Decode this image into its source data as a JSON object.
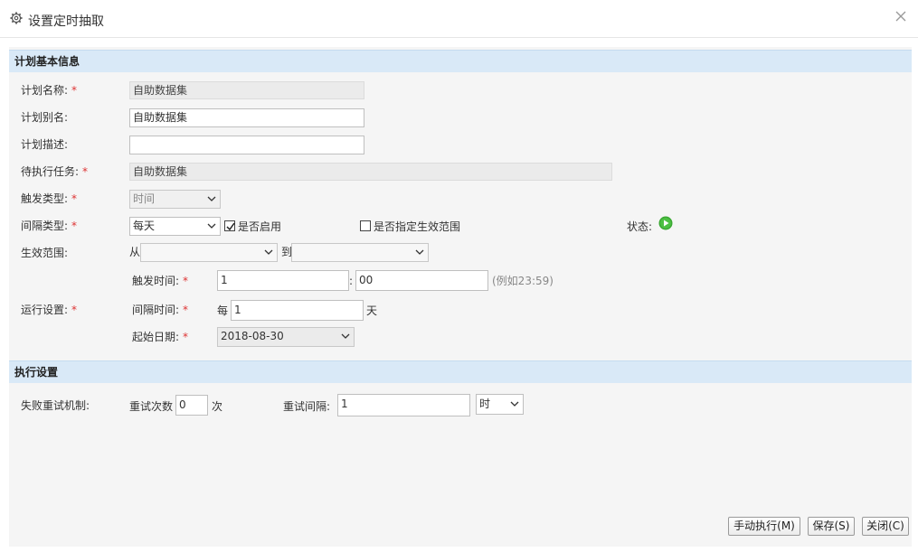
{
  "dialog": {
    "title": "设置定时抽取"
  },
  "sections": {
    "basic": "计划基本信息",
    "exec": "执行设置"
  },
  "form": {
    "plan_name_label": "计划名称:",
    "plan_name_value": "自助数据集",
    "plan_alias_label": "计划别名:",
    "plan_alias_value": "自助数据集",
    "plan_desc_label": "计划描述:",
    "plan_desc_value": "",
    "task_label": "待执行任务:",
    "task_value": "自助数据集",
    "trigger_type_label": "触发类型:",
    "trigger_type_value": "时间",
    "interval_type_label": "间隔类型:",
    "interval_type_value": "每天",
    "enable_label": "是否启用",
    "enable_checked": true,
    "range_spec_label": "是否指定生效范围",
    "range_spec_checked": false,
    "status_label": "状态:",
    "effective_range_label": "生效范围:",
    "from_label": "从",
    "to_label": "到",
    "from_value": "",
    "to_value": "",
    "run_settings_label": "运行设置:",
    "trigger_time_label": "触发时间:",
    "trigger_hour": "1",
    "time_sep": ":",
    "trigger_minute": "00",
    "trigger_time_hint": "(例如23:59)",
    "interval_time_label": "间隔时间:",
    "every_label": "每",
    "interval_value": "1",
    "day_unit": "天",
    "start_date_label": "起始日期:",
    "start_date_value": "2018-08-30",
    "required_mark": "*"
  },
  "exec": {
    "retry_label": "失败重试机制:",
    "retry_count_label": "重试次数",
    "retry_count_value": "0",
    "retry_count_unit": "次",
    "retry_interval_label": "重试间隔:",
    "retry_interval_value": "1",
    "retry_interval_unit": "时"
  },
  "buttons": {
    "manual": "手动执行(M)",
    "save": "保存(S)",
    "close": "关闭(C)"
  },
  "colors": {
    "section_bg": "#d9e9f7",
    "required": "#d33333",
    "status_green": "#3aa832"
  }
}
